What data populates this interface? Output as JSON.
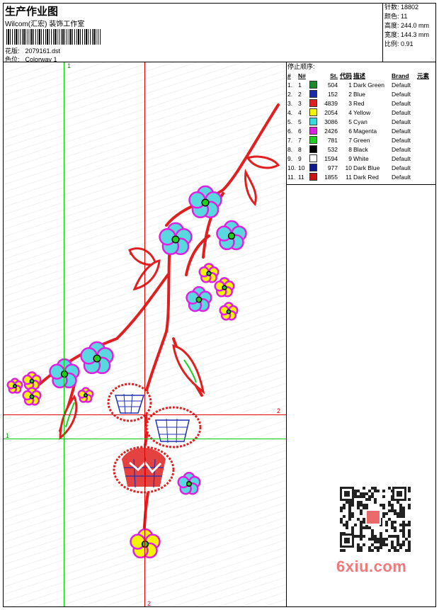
{
  "header": {
    "title": "生产作业图",
    "company": "Wilcom(汇宏) 装饰工作室",
    "design_label": "花版:",
    "design_value": "2079161.dst",
    "colorway_label": "色位:",
    "colorway_value": "Colorway 1"
  },
  "stats": {
    "stitches_label": "针数:",
    "stitches_value": "18802",
    "colors_label": "颜色:",
    "colors_value": "11",
    "height_label": "高度:",
    "height_value": "244.0 mm",
    "width_label": "宽度:",
    "width_value": "144.3 mm",
    "scale_label": "比例:",
    "scale_value": "0.91"
  },
  "stop_sequence": {
    "title": "停止顺序:",
    "headers": [
      "#",
      "N#",
      "",
      "St.",
      "代码",
      "描述",
      "Brand",
      "元素"
    ],
    "rows": [
      {
        "num": "1.",
        "n": "1",
        "color": "#1a8a2a",
        "st": "504",
        "code": "1",
        "desc": "Dark Green",
        "brand": "Default"
      },
      {
        "num": "2.",
        "n": "2",
        "color": "#1a2aa8",
        "st": "152",
        "code": "2",
        "desc": "Blue",
        "brand": "Default"
      },
      {
        "num": "3.",
        "n": "3",
        "color": "#e02020",
        "st": "4839",
        "code": "3",
        "desc": "Red",
        "brand": "Default"
      },
      {
        "num": "4.",
        "n": "4",
        "color": "#f5f500",
        "st": "2054",
        "code": "4",
        "desc": "Yellow",
        "brand": "Default"
      },
      {
        "num": "5.",
        "n": "5",
        "color": "#38d8e0",
        "st": "3086",
        "code": "5",
        "desc": "Cyan",
        "brand": "Default"
      },
      {
        "num": "6.",
        "n": "6",
        "color": "#e020e0",
        "st": "2426",
        "code": "6",
        "desc": "Magenta",
        "brand": "Default"
      },
      {
        "num": "7.",
        "n": "7",
        "color": "#20d020",
        "st": "781",
        "code": "7",
        "desc": "Green",
        "brand": "Default"
      },
      {
        "num": "8.",
        "n": "8",
        "color": "#000000",
        "st": "532",
        "code": "8",
        "desc": "Black",
        "brand": "Default"
      },
      {
        "num": "9.",
        "n": "9",
        "color": "#ffffff",
        "st": "1594",
        "code": "9",
        "desc": "White",
        "brand": "Default"
      },
      {
        "num": "10.",
        "n": "10",
        "color": "#101890",
        "st": "977",
        "code": "10",
        "desc": "Dark Blue",
        "brand": "Default"
      },
      {
        "num": "11.",
        "n": "11",
        "color": "#c81414",
        "st": "1855",
        "code": "11",
        "desc": "Dark Red",
        "brand": "Default"
      }
    ]
  },
  "crosshair_labels": {
    "v1_top": "1",
    "h2_right": "2",
    "h1_left": "1",
    "v2_bottom": "2"
  },
  "watermark": "6xiu.com",
  "colors": {
    "stem": "#e02020",
    "petal_cyan": "#5ad8e0",
    "outline": "#e020e0",
    "yellow": "#f5f500",
    "leaf_green": "#20d020",
    "blue_net": "#2030b0",
    "guide_green": "#00cc00",
    "guide_red": "#e00000"
  }
}
